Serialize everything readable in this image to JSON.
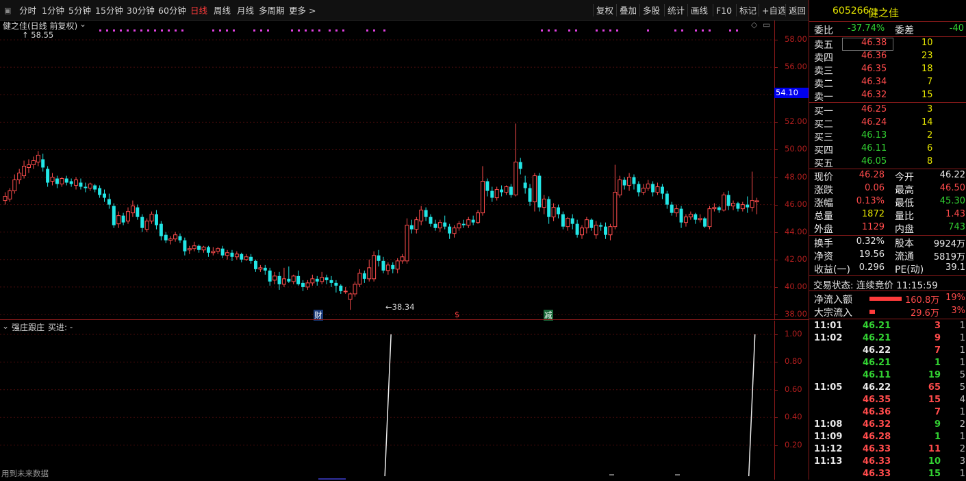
{
  "toolbar": {
    "periods": [
      "分时",
      "1分钟",
      "5分钟",
      "15分钟",
      "30分钟",
      "60分钟",
      "日线",
      "周线",
      "月线",
      "多周期",
      "更多 >"
    ],
    "active_period": "日线",
    "right_buttons": [
      "复权",
      "叠加",
      "多股",
      "统计",
      "画线",
      "F10",
      "标记",
      "+自选",
      "返回"
    ]
  },
  "main": {
    "title": "健之佳(日线 前复权)",
    "y_ticks": [
      "58.00",
      "56.00",
      "54.00",
      "52.00",
      "50.00",
      "48.00",
      "46.00",
      "44.00",
      "42.00",
      "40.00",
      "38.00"
    ],
    "current_price_tag": "54.10",
    "max_label": "58.55",
    "min_label": "38.34",
    "event_markers": [
      "财",
      "$",
      "减"
    ]
  },
  "indicator": {
    "title": "强庄跟庄",
    "subtitle": "买进: -",
    "y_ticks": [
      "1.00",
      "0.80",
      "0.60",
      "0.40",
      "0.20"
    ],
    "footer_note": "用到未来数据"
  },
  "panel": {
    "code": "605266",
    "name": "健之佳",
    "weibi_label": "委比",
    "weibi_value": "-37.74%",
    "weicha_label": "委差",
    "weicha_value": "-40",
    "asks": [
      {
        "label": "卖五",
        "price": "46.38",
        "vol": "10"
      },
      {
        "label": "卖四",
        "price": "46.36",
        "vol": "23"
      },
      {
        "label": "卖三",
        "price": "46.35",
        "vol": "18"
      },
      {
        "label": "卖二",
        "price": "46.34",
        "vol": "7"
      },
      {
        "label": "卖一",
        "price": "46.32",
        "vol": "15"
      }
    ],
    "bids": [
      {
        "label": "买一",
        "price": "46.25",
        "vol": "3",
        "color": "red"
      },
      {
        "label": "买二",
        "price": "46.24",
        "vol": "14",
        "color": "red"
      },
      {
        "label": "买三",
        "price": "46.13",
        "vol": "2",
        "color": "grn"
      },
      {
        "label": "买四",
        "price": "46.11",
        "vol": "6",
        "color": "grn"
      },
      {
        "label": "买五",
        "price": "46.05",
        "vol": "8",
        "color": "grn"
      }
    ],
    "stats": [
      {
        "l1": "现价",
        "v1": "46.28",
        "c1": "red",
        "l2": "今开",
        "v2": "46.22",
        "c2": "wht"
      },
      {
        "l1": "涨跌",
        "v1": "0.06",
        "c1": "red",
        "l2": "最高",
        "v2": "46.50",
        "c2": "red"
      },
      {
        "l1": "涨幅",
        "v1": "0.13%",
        "c1": "red",
        "l2": "最低",
        "v2": "45.30",
        "c2": "grn"
      },
      {
        "l1": "总量",
        "v1": "1872",
        "c1": "yel",
        "l2": "量比",
        "v2": "1.43",
        "c2": "red"
      },
      {
        "l1": "外盘",
        "v1": "1129",
        "c1": "red",
        "l2": "内盘",
        "v2": "743",
        "c2": "grn"
      }
    ],
    "stats2": [
      {
        "l1": "换手",
        "v1": "0.32%",
        "l2": "股本",
        "v2": "9924万"
      },
      {
        "l1": "净资",
        "v1": "19.56",
        "l2": "流通",
        "v2": "5819万"
      },
      {
        "l1": "收益(一)",
        "v1": "0.296",
        "l2": "PE(动)",
        "v2": "39.1"
      }
    ],
    "trade_status": "交易状态: 连续竞价 11:15:59",
    "net_inflow_label": "净流入额",
    "net_inflow_value": "160.8万",
    "net_inflow_pct": "19%",
    "block_inflow_label": "大宗流入",
    "block_inflow_value": "29.6万",
    "block_inflow_pct": "3%",
    "ticks": [
      {
        "time": "11:01",
        "price": "46.21",
        "pc": "grn",
        "vol": "3",
        "vc": "red",
        "n": "1"
      },
      {
        "time": "11:02",
        "price": "46.21",
        "pc": "grn",
        "vol": "9",
        "vc": "red",
        "n": "1"
      },
      {
        "time": "",
        "price": "46.22",
        "pc": "wht",
        "vol": "7",
        "vc": "red",
        "n": "1"
      },
      {
        "time": "",
        "price": "46.21",
        "pc": "grn",
        "vol": "1",
        "vc": "grn",
        "n": "1"
      },
      {
        "time": "",
        "price": "46.11",
        "pc": "grn",
        "vol": "19",
        "vc": "grn",
        "n": "5"
      },
      {
        "time": "11:05",
        "price": "46.22",
        "pc": "wht",
        "vol": "65",
        "vc": "red",
        "n": "5"
      },
      {
        "time": "",
        "price": "46.35",
        "pc": "red",
        "vol": "15",
        "vc": "red",
        "n": "4"
      },
      {
        "time": "",
        "price": "46.36",
        "pc": "red",
        "vol": "7",
        "vc": "red",
        "n": "1"
      },
      {
        "time": "11:08",
        "price": "46.32",
        "pc": "red",
        "vol": "9",
        "vc": "grn",
        "n": "2"
      },
      {
        "time": "11:09",
        "price": "46.28",
        "pc": "red",
        "vol": "1",
        "vc": "grn",
        "n": "1"
      },
      {
        "time": "11:12",
        "price": "46.33",
        "pc": "red",
        "vol": "11",
        "vc": "red",
        "n": "2"
      },
      {
        "time": "11:13",
        "price": "46.33",
        "pc": "red",
        "vol": "10",
        "vc": "grn",
        "n": "3"
      },
      {
        "time": "",
        "price": "46.33",
        "pc": "red",
        "vol": "15",
        "vc": "grn",
        "n": "1"
      }
    ]
  },
  "chart_data": {
    "type": "candlestick",
    "ylim": [
      37.6,
      59.4
    ],
    "candles": [
      [
        46.3,
        46.6,
        46.0,
        46.9
      ],
      [
        46.4,
        47.0,
        46.2,
        47.2
      ],
      [
        47.0,
        47.8,
        46.8,
        48.2
      ],
      [
        47.8,
        48.3,
        47.5,
        48.6
      ],
      [
        48.1,
        48.8,
        47.9,
        49.2
      ],
      [
        48.7,
        48.9,
        48.3,
        49.3
      ],
      [
        48.9,
        49.2,
        48.6,
        49.5
      ],
      [
        49.1,
        49.6,
        48.8,
        49.9
      ],
      [
        49.3,
        48.7,
        48.4,
        49.7
      ],
      [
        48.6,
        47.6,
        47.3,
        48.8
      ],
      [
        47.7,
        48.0,
        47.4,
        48.3
      ],
      [
        47.9,
        47.5,
        47.2,
        48.1
      ],
      [
        47.5,
        47.9,
        47.3,
        48.0
      ],
      [
        47.9,
        47.6,
        47.4,
        48.1
      ],
      [
        47.7,
        47.5,
        47.3,
        47.9
      ],
      [
        47.4,
        47.8,
        47.1,
        48.0
      ],
      [
        47.6,
        47.3,
        47.1,
        47.9
      ],
      [
        47.3,
        47.2,
        46.9,
        47.6
      ],
      [
        47.2,
        47.5,
        47.0,
        47.6
      ],
      [
        47.4,
        47.1,
        46.9,
        47.5
      ],
      [
        47.2,
        46.7,
        46.5,
        47.4
      ],
      [
        46.8,
        46.5,
        46.2,
        47.1
      ],
      [
        46.4,
        46.0,
        45.7,
        46.8
      ],
      [
        45.9,
        44.5,
        44.3,
        46.1
      ],
      [
        44.6,
        45.2,
        44.3,
        45.5
      ],
      [
        45.2,
        44.7,
        44.5,
        45.4
      ],
      [
        44.8,
        45.5,
        44.6,
        45.8
      ],
      [
        45.4,
        45.9,
        45.1,
        46.3
      ],
      [
        45.8,
        45.1,
        44.9,
        46.0
      ],
      [
        45.1,
        44.3,
        44.0,
        45.3
      ],
      [
        44.2,
        44.8,
        44.0,
        45.0
      ],
      [
        44.8,
        45.3,
        44.6,
        45.5
      ],
      [
        45.3,
        44.5,
        44.2,
        45.6
      ],
      [
        44.6,
        43.7,
        43.4,
        44.8
      ],
      [
        43.8,
        43.4,
        43.2,
        44.0
      ],
      [
        43.4,
        43.5,
        43.1,
        43.7
      ],
      [
        43.5,
        43.8,
        43.3,
        44.0
      ],
      [
        43.7,
        43.4,
        43.2,
        43.9
      ],
      [
        43.4,
        42.6,
        42.3,
        43.6
      ],
      [
        42.7,
        42.8,
        42.4,
        43.0
      ],
      [
        42.8,
        43.0,
        42.6,
        43.3
      ],
      [
        43.0,
        42.7,
        42.5,
        43.1
      ],
      [
        42.7,
        42.9,
        42.5,
        43.0
      ],
      [
        42.9,
        42.5,
        42.2,
        43.0
      ],
      [
        42.5,
        42.6,
        42.3,
        42.9
      ],
      [
        42.6,
        42.8,
        42.4,
        42.9
      ],
      [
        42.8,
        42.3,
        42.1,
        43.0
      ],
      [
        42.3,
        42.5,
        42.0,
        42.7
      ],
      [
        42.5,
        42.2,
        41.9,
        42.7
      ],
      [
        42.2,
        42.4,
        42.0,
        42.6
      ],
      [
        42.4,
        42.0,
        41.8,
        42.5
      ],
      [
        42.0,
        42.2,
        41.9,
        42.4
      ],
      [
        42.2,
        41.9,
        41.7,
        42.4
      ],
      [
        41.9,
        41.3,
        41.1,
        42.0
      ],
      [
        41.3,
        41.4,
        41.1,
        41.6
      ],
      [
        41.4,
        41.2,
        40.9,
        41.6
      ],
      [
        41.2,
        40.4,
        40.1,
        41.4
      ],
      [
        40.5,
        40.8,
        40.2,
        41.1
      ],
      [
        40.8,
        40.2,
        39.8,
        41.1
      ],
      [
        40.2,
        40.6,
        40.0,
        41.4
      ],
      [
        40.6,
        40.4,
        40.3,
        41.5
      ],
      [
        40.4,
        40.8,
        40.2,
        40.9
      ],
      [
        40.8,
        40.2,
        40.1,
        41.2
      ],
      [
        40.3,
        40.0,
        39.7,
        40.5
      ],
      [
        40.0,
        40.3,
        39.8,
        40.5
      ],
      [
        40.3,
        40.6,
        40.1,
        40.9
      ],
      [
        40.6,
        40.4,
        40.1,
        40.8
      ],
      [
        40.4,
        40.7,
        40.2,
        41.1
      ],
      [
        40.7,
        40.5,
        40.2,
        40.9
      ],
      [
        40.5,
        40.3,
        40.0,
        40.8
      ],
      [
        40.3,
        40.1,
        39.6,
        40.5
      ],
      [
        40.1,
        39.7,
        39.5,
        40.2
      ],
      [
        39.7,
        39.7,
        39.5,
        40.0
      ],
      [
        39.1,
        39.5,
        38.34,
        39.6
      ],
      [
        39.5,
        40.2,
        39.3,
        40.4
      ],
      [
        40.2,
        41.0,
        40.0,
        41.3
      ],
      [
        41.0,
        40.6,
        40.3,
        41.2
      ],
      [
        40.6,
        41.4,
        40.4,
        42.0
      ],
      [
        40.6,
        42.3,
        40.4,
        42.6
      ],
      [
        42.3,
        41.9,
        41.5,
        42.7
      ],
      [
        41.9,
        41.2,
        41.0,
        42.2
      ],
      [
        41.2,
        41.6,
        40.9,
        41.8
      ],
      [
        41.6,
        41.3,
        41.0,
        41.8
      ],
      [
        41.3,
        41.9,
        41.0,
        42.1
      ],
      [
        41.9,
        42.2,
        41.7,
        42.4
      ],
      [
        41.9,
        44.5,
        41.7,
        45.0
      ],
      [
        44.5,
        44.2,
        43.9,
        44.9
      ],
      [
        44.2,
        44.9,
        43.9,
        45.1
      ],
      [
        44.8,
        45.6,
        44.5,
        45.9
      ],
      [
        45.6,
        45.1,
        44.8,
        45.8
      ],
      [
        45.1,
        44.6,
        44.4,
        45.3
      ],
      [
        44.6,
        44.3,
        44.1,
        44.9
      ],
      [
        44.3,
        44.7,
        44.0,
        44.9
      ],
      [
        44.7,
        44.4,
        44.2,
        45.2
      ],
      [
        44.4,
        43.9,
        43.5,
        44.6
      ],
      [
        43.9,
        44.3,
        43.6,
        44.5
      ],
      [
        44.3,
        44.6,
        44.1,
        44.8
      ],
      [
        44.6,
        44.5,
        44.3,
        44.9
      ],
      [
        44.5,
        44.9,
        44.3,
        45.1
      ],
      [
        44.9,
        44.7,
        44.5,
        45.2
      ],
      [
        44.7,
        45.4,
        44.6,
        45.6
      ],
      [
        45.4,
        47.7,
        45.2,
        48.8
      ],
      [
        47.7,
        47.0,
        46.6,
        47.9
      ],
      [
        47.0,
        46.5,
        46.2,
        47.3
      ],
      [
        46.5,
        47.1,
        46.3,
        47.3
      ],
      [
        47.1,
        46.9,
        46.6,
        47.4
      ],
      [
        46.9,
        47.3,
        46.7,
        47.4
      ],
      [
        47.3,
        46.7,
        46.5,
        47.5
      ],
      [
        46.7,
        49.1,
        46.6,
        51.9
      ],
      [
        49.1,
        48.6,
        48.2,
        49.4
      ],
      [
        47.6,
        47.2,
        46.8,
        48.1
      ],
      [
        47.2,
        46.2,
        45.9,
        47.5
      ],
      [
        46.2,
        48.1,
        45.5,
        48.3
      ],
      [
        48.1,
        45.8,
        45.5,
        48.3
      ],
      [
        45.8,
        46.4,
        45.3,
        46.7
      ],
      [
        46.4,
        45.1,
        44.6,
        46.6
      ],
      [
        45.1,
        45.8,
        44.8,
        46.1
      ],
      [
        45.8,
        45.3,
        45.0,
        46.0
      ],
      [
        45.3,
        44.4,
        44.2,
        45.5
      ],
      [
        44.4,
        45.0,
        44.1,
        45.1
      ],
      [
        45.0,
        44.6,
        44.2,
        45.3
      ],
      [
        44.6,
        43.8,
        43.6,
        44.9
      ],
      [
        43.8,
        44.3,
        43.5,
        44.5
      ],
      [
        44.3,
        44.9,
        43.9,
        45.1
      ],
      [
        44.9,
        44.3,
        44.1,
        45.0
      ],
      [
        43.8,
        44.5,
        43.5,
        44.8
      ],
      [
        44.5,
        44.4,
        44.1,
        44.7
      ],
      [
        44.4,
        43.8,
        43.5,
        44.7
      ],
      [
        43.8,
        44.4,
        43.4,
        44.6
      ],
      [
        44.4,
        46.9,
        44.2,
        48.9
      ],
      [
        46.7,
        47.8,
        46.5,
        48.1
      ],
      [
        47.8,
        47.4,
        47.1,
        48.0
      ],
      [
        47.4,
        48.0,
        47.0,
        48.3
      ],
      [
        48.0,
        47.5,
        47.1,
        48.2
      ],
      [
        47.5,
        46.9,
        46.6,
        47.7
      ],
      [
        46.9,
        47.2,
        46.7,
        47.5
      ],
      [
        47.2,
        47.5,
        47.0,
        47.8
      ],
      [
        47.5,
        46.9,
        46.6,
        47.7
      ],
      [
        46.9,
        47.3,
        46.7,
        47.6
      ],
      [
        47.3,
        46.8,
        46.4,
        47.5
      ],
      [
        46.8,
        46.0,
        45.7,
        47.0
      ],
      [
        46.0,
        45.4,
        45.2,
        46.2
      ],
      [
        45.4,
        45.7,
        45.1,
        46.0
      ],
      [
        45.7,
        44.7,
        44.3,
        45.9
      ],
      [
        44.7,
        45.1,
        44.4,
        45.3
      ],
      [
        45.1,
        45.3,
        44.9,
        45.5
      ],
      [
        45.3,
        44.9,
        44.6,
        45.4
      ],
      [
        44.9,
        45.0,
        44.7,
        45.3
      ],
      [
        45.0,
        44.4,
        44.3,
        45.1
      ],
      [
        44.4,
        45.7,
        44.2,
        45.9
      ],
      [
        45.7,
        45.8,
        45.5,
        46.1
      ],
      [
        45.8,
        45.6,
        45.4,
        45.9
      ],
      [
        45.6,
        46.7,
        45.5,
        46.9
      ],
      [
        46.7,
        45.9,
        45.6,
        47.0
      ],
      [
        45.9,
        46.1,
        45.6,
        46.3
      ],
      [
        46.1,
        45.7,
        45.5,
        46.2
      ],
      [
        45.7,
        46.0,
        45.5,
        46.2
      ],
      [
        46.0,
        45.8,
        45.4,
        46.6
      ],
      [
        45.8,
        46.3,
        45.5,
        48.4
      ],
      [
        46.2,
        46.28,
        45.3,
        46.5
      ]
    ],
    "buy_signal_spikes": [
      0.505,
      0.975
    ]
  }
}
